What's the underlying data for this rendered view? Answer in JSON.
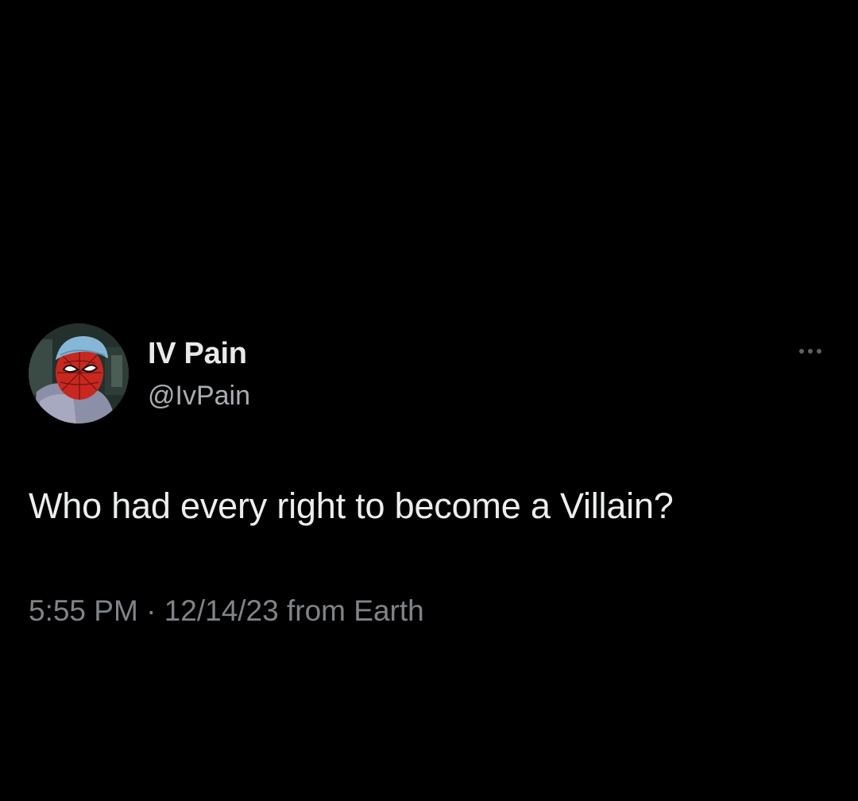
{
  "tweet": {
    "author": {
      "display_name": "IV Pain",
      "handle": "@IvPain",
      "avatar_icon": "spider-man-avatar-icon"
    },
    "text": "Who had every right to become a Villain?",
    "time": "5:55 PM",
    "separator": " · ",
    "date_location": "12/14/23 from Earth",
    "more_icon": "more-options-icon"
  },
  "colors": {
    "background": "#000000",
    "primary_text": "#e7e9ea",
    "secondary_text": "#7f8488"
  }
}
